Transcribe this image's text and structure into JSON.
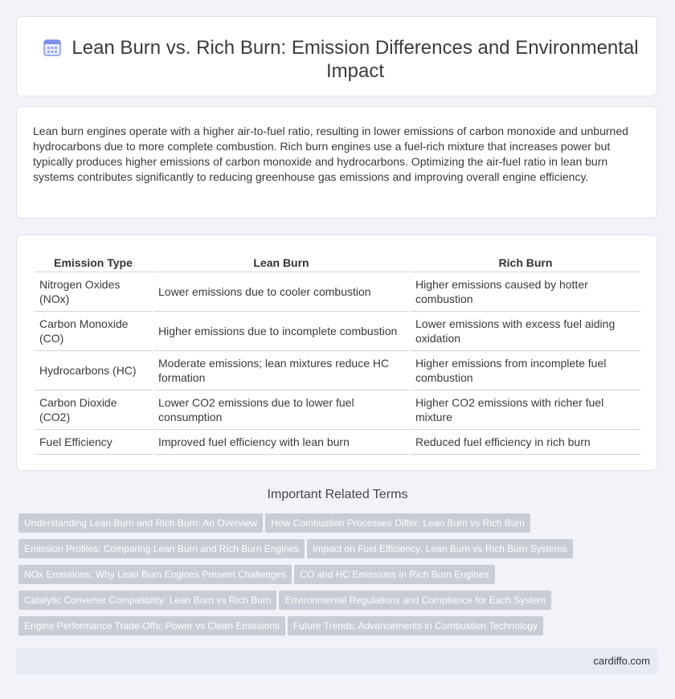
{
  "header": {
    "icon": "calendar-icon",
    "title": "Lean Burn vs. Rich Burn: Emission Differences and Environmental Impact"
  },
  "intro": {
    "text": "Lean burn engines operate with a higher air-to-fuel ratio, resulting in lower emissions of carbon monoxide and unburned hydrocarbons due to more complete combustion. Rich burn engines use a fuel-rich mixture that increases power but typically produces higher emissions of carbon monoxide and hydrocarbons. Optimizing the air-fuel ratio in lean burn systems contributes significantly to reducing greenhouse gas emissions and improving overall engine efficiency."
  },
  "table": {
    "headers": [
      "Emission Type",
      "Lean Burn",
      "Rich Burn"
    ],
    "rows": [
      [
        "Nitrogen Oxides (NOx)",
        "Lower emissions due to cooler combustion",
        "Higher emissions caused by hotter combustion"
      ],
      [
        "Carbon Monoxide (CO)",
        "Higher emissions due to incomplete combustion",
        "Lower emissions with excess fuel aiding oxidation"
      ],
      [
        "Hydrocarbons (HC)",
        "Moderate emissions; lean mixtures reduce HC formation",
        "Higher emissions from incomplete fuel combustion"
      ],
      [
        "Carbon Dioxide (CO2)",
        "Lower CO2 emissions due to lower fuel consumption",
        "Higher CO2 emissions with richer fuel mixture"
      ],
      [
        "Fuel Efficiency",
        "Improved fuel efficiency with lean burn",
        "Reduced fuel efficiency in rich burn"
      ]
    ]
  },
  "related": {
    "title": "Important Related Terms",
    "tags": [
      "Understanding Lean Burn and Rich Burn: An Overview",
      "How Combustion Processes Differ: Lean Burn vs Rich Burn",
      "Emission Profiles: Comparing Lean Burn and Rich Burn Engines",
      "Impact on Fuel Efficiency: Lean Burn vs Rich Burn Systems",
      "NOx Emissions: Why Lean Burn Engines Present Challenges",
      "CO and HC Emissions in Rich Burn Engines",
      "Catalytic Converter Compatibility: Lean Burn vs Rich Burn",
      "Environmental Regulations and Compliance for Each System",
      "Engine Performance Trade-Offs: Power vs Clean Emissions",
      "Future Trends: Advancements in Combustion Technology"
    ]
  },
  "footer": {
    "site": "cardiffo.com"
  },
  "colors": {
    "background": "#f1f3f8",
    "tag_background": "#c8ccd4",
    "footer_background": "#e5eaf5",
    "icon_accent": "#6c7fe0"
  }
}
